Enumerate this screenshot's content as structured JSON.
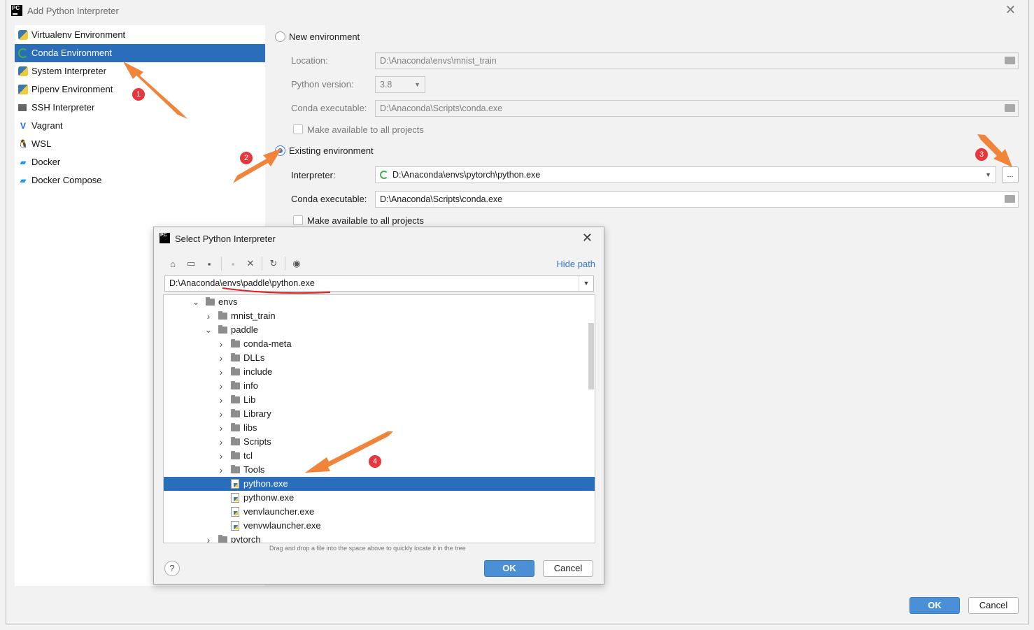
{
  "window": {
    "title": "Add Python Interpreter",
    "close_glyph": "✕"
  },
  "sidebar": {
    "items": [
      {
        "label": "Virtualenv Environment",
        "icon": "virtualenv-icon"
      },
      {
        "label": "Conda Environment",
        "icon": "conda-icon",
        "selected": true
      },
      {
        "label": "System Interpreter",
        "icon": "python-icon"
      },
      {
        "label": "Pipenv Environment",
        "icon": "pipenv-icon"
      },
      {
        "label": "SSH Interpreter",
        "icon": "ssh-icon"
      },
      {
        "label": "Vagrant",
        "icon": "vagrant-icon"
      },
      {
        "label": "WSL",
        "icon": "linux-icon"
      },
      {
        "label": "Docker",
        "icon": "docker-icon"
      },
      {
        "label": "Docker Compose",
        "icon": "docker-compose-icon"
      }
    ]
  },
  "new_env": {
    "radio_label": "New environment",
    "location_label": "Location:",
    "location_value": "D:\\Anaconda\\envs\\mnist_train",
    "python_version_label": "Python version:",
    "python_version_value": "3.8",
    "conda_exe_label": "Conda executable:",
    "conda_exe_value": "D:\\Anaconda\\Scripts\\conda.exe",
    "make_available_label": "Make available to all projects"
  },
  "existing_env": {
    "radio_label": "Existing environment",
    "interpreter_label": "Interpreter:",
    "interpreter_value": "D:\\Anaconda\\envs\\pytorch\\python.exe",
    "browse_label": "...",
    "conda_exe_label": "Conda executable:",
    "conda_exe_value": "D:\\Anaconda\\Scripts\\conda.exe",
    "make_available_label": "Make available to all projects"
  },
  "footer": {
    "ok_label": "OK",
    "cancel_label": "Cancel"
  },
  "select_dialog": {
    "title": "Select Python Interpreter",
    "hide_path_label": "Hide path",
    "path_value": "D:\\Anaconda\\envs\\paddle\\python.exe",
    "drop_hint": "Drag and drop a file into the space above to quickly locate it in the tree",
    "help_label": "?",
    "ok_label": "OK",
    "cancel_label": "Cancel",
    "tree": [
      {
        "label": "envs",
        "kind": "folder",
        "depth": 0,
        "expanded": true
      },
      {
        "label": "mnist_train",
        "kind": "folder",
        "depth": 1,
        "expanded": false
      },
      {
        "label": "paddle",
        "kind": "folder",
        "depth": 1,
        "expanded": true
      },
      {
        "label": "conda-meta",
        "kind": "folder",
        "depth": 2,
        "expanded": false
      },
      {
        "label": "DLLs",
        "kind": "folder",
        "depth": 2,
        "expanded": false
      },
      {
        "label": "include",
        "kind": "folder",
        "depth": 2,
        "expanded": false
      },
      {
        "label": "info",
        "kind": "folder",
        "depth": 2,
        "expanded": false
      },
      {
        "label": "Lib",
        "kind": "folder",
        "depth": 2,
        "expanded": false
      },
      {
        "label": "Library",
        "kind": "folder",
        "depth": 2,
        "expanded": false
      },
      {
        "label": "libs",
        "kind": "folder",
        "depth": 2,
        "expanded": false
      },
      {
        "label": "Scripts",
        "kind": "folder",
        "depth": 2,
        "expanded": false
      },
      {
        "label": "tcl",
        "kind": "folder",
        "depth": 2,
        "expanded": false
      },
      {
        "label": "Tools",
        "kind": "folder",
        "depth": 2,
        "expanded": false
      },
      {
        "label": "python.exe",
        "kind": "file",
        "depth": 2,
        "selected": true
      },
      {
        "label": "pythonw.exe",
        "kind": "file",
        "depth": 2
      },
      {
        "label": "venvlauncher.exe",
        "kind": "file",
        "depth": 2
      },
      {
        "label": "venvwlauncher.exe",
        "kind": "file",
        "depth": 2
      },
      {
        "label": "pytorch",
        "kind": "folder",
        "depth": 1,
        "expanded": false
      }
    ]
  },
  "annotations": [
    "1",
    "2",
    "3",
    "4"
  ],
  "colors": {
    "selection": "#2a6ebb",
    "annotation": "#e8363d",
    "arrow": "#f0843a",
    "primary_button": "#4b8fd6"
  }
}
